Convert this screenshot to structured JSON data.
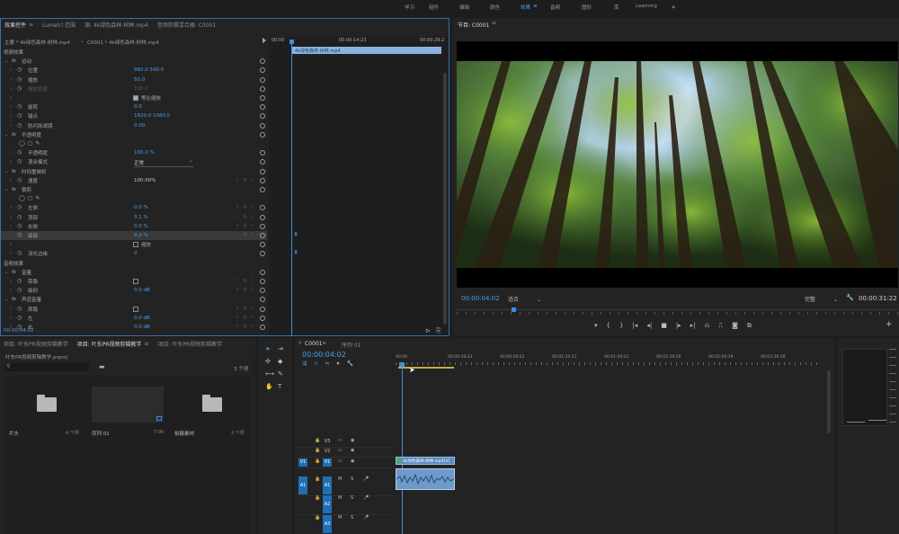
{
  "top_menu": {
    "items": [
      "学习",
      "组件",
      "编辑",
      "颜色",
      "效果",
      "音频",
      "图形",
      "库",
      "Learning"
    ],
    "active": "效果",
    "more": "»"
  },
  "effect_panel": {
    "tabs": [
      "效果控件",
      "Lumetri 范围",
      "源: 4k绿色森林-树林.mp4",
      "音频剪辑混合器: C0001"
    ],
    "breadcrumb_master": "主要 * 4k绿色森林-树林.mp4",
    "breadcrumb_seq": "C0001 * 4k绿色森林-树林.mp4",
    "mini_timecodes": [
      "00:00",
      "00:00:14:23",
      "00:00:29:2"
    ],
    "clip_label": "4k绿色森林-树林.mp4",
    "rows": [
      {
        "t": "section",
        "label": "视频效果"
      },
      {
        "t": "group",
        "label": "运动",
        "fx": true
      },
      {
        "t": "prop",
        "label": "位置",
        "val": "960.0    540.0"
      },
      {
        "t": "prop",
        "label": "缩放",
        "val": "50.0"
      },
      {
        "t": "prop",
        "label": "缩放宽度",
        "val": "100.0",
        "dim": true
      },
      {
        "t": "check",
        "label": "等比缩放",
        "checked": true
      },
      {
        "t": "prop",
        "label": "旋转",
        "val": "0.0"
      },
      {
        "t": "prop",
        "label": "锚点",
        "val": "1920.0    1080.0"
      },
      {
        "t": "prop",
        "label": "防闪烁滤镜",
        "val": "0.00"
      },
      {
        "t": "group",
        "label": "不透明度",
        "fx": true
      },
      {
        "t": "shapes"
      },
      {
        "t": "prop",
        "label": "不透明度",
        "val": "100.0 %"
      },
      {
        "t": "select",
        "label": "混合模式",
        "val": "正常"
      },
      {
        "t": "group",
        "label": "时间重映射",
        "fx": false
      },
      {
        "t": "prop",
        "label": "速度",
        "val": "100.00%",
        "white": true
      },
      {
        "t": "group",
        "label": "裁剪",
        "fx": true
      },
      {
        "t": "shapes"
      },
      {
        "t": "prop",
        "label": "左侧",
        "val": "0.0 %"
      },
      {
        "t": "prop",
        "label": "顶部",
        "val": "3.1 %"
      },
      {
        "t": "prop",
        "label": "右侧",
        "val": "0.0 %"
      },
      {
        "t": "prop",
        "label": "底部",
        "val": "9.2 %",
        "hl": true
      },
      {
        "t": "check",
        "label": "缩放",
        "checked": false
      },
      {
        "t": "prop",
        "label": "羽化边缘",
        "val": "0"
      },
      {
        "t": "section",
        "label": "音频效果"
      },
      {
        "t": "group",
        "label": "音量",
        "fx": true
      },
      {
        "t": "checkrow",
        "label": "旁路"
      },
      {
        "t": "prop",
        "label": "级别",
        "val": "0.0 dB"
      },
      {
        "t": "group",
        "label": "声道音量",
        "fx": true
      },
      {
        "t": "checkrow",
        "label": "旁路"
      },
      {
        "t": "prop",
        "label": "左",
        "val": "0.0 dB"
      },
      {
        "t": "prop",
        "label": "右",
        "val": "0.0 dB"
      }
    ],
    "timecode": "00:00:04:02"
  },
  "program_monitor": {
    "tab": "节目: C0001",
    "timecode": "00:00:04:02",
    "fit": "适合",
    "quality": "完整",
    "duration": "00:00:31:22"
  },
  "project_panel": {
    "tabs": [
      "项目: 叶东PR视频剪辑教学",
      "项目: 叶东PR视频剪辑教学",
      "项目: 叶东PR视频剪辑教学"
    ],
    "file": "叶东PR视频剪辑教学.prproj",
    "count": "3 个项",
    "items": [
      {
        "name": "片头",
        "info": "4 个项"
      },
      {
        "name": "序列 01",
        "info": "7:00"
      },
      {
        "name": "拍摄素材",
        "info": "2 个项"
      }
    ]
  },
  "timeline": {
    "tabs": [
      "C0001",
      "序列 01"
    ],
    "timecode": "00:00:04:02",
    "ruler": [
      "00:00",
      "00:00:29:23",
      "00:00:59:22",
      "00:01:29:21",
      "00:01:59:21",
      "00:02:29:20",
      "00:02:59:19",
      "00:03:29:18"
    ],
    "video_tracks": [
      "V3",
      "V2",
      "V1"
    ],
    "audio_tracks": [
      "A1",
      "A2",
      "A3"
    ],
    "clip_label": "4k绿色森林-树林.mp4[V]"
  }
}
